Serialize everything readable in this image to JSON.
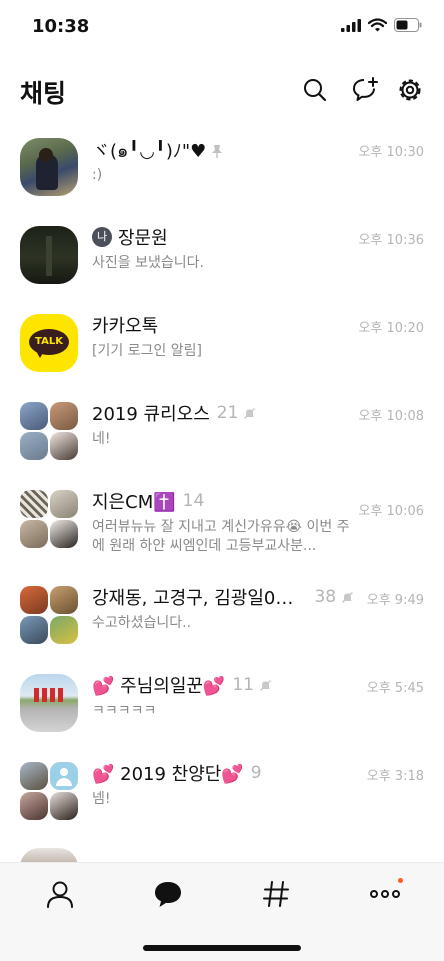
{
  "status_bar": {
    "time": "10:38"
  },
  "header": {
    "title": "채팅"
  },
  "chats": [
    {
      "name": "ヾ(๑╹◡╹)ﾉ\"♥",
      "message": ":)",
      "time": "오후 10:30",
      "pinned": true
    },
    {
      "name": "장문원",
      "message": "사진을 보냈습니다.",
      "time": "오후 10:36",
      "badge": "나"
    },
    {
      "name": "카카오톡",
      "message": "[기기 로그인 알림]",
      "time": "오후 10:20",
      "avatar_text": "TALK"
    },
    {
      "name": "2019 큐리오스",
      "count": "21",
      "message": "네!",
      "time": "오후 10:08",
      "muted": true
    },
    {
      "name": "지은CM✝️",
      "count": "14",
      "message": "여러뷰뉴뉴 잘 지내고 계신가유유😭 이번 주에 원래 하얀 씨엠인데 고등부교사분...",
      "time": "오후 10:06"
    },
    {
      "name": "강재동, 고경구, 김광일01...",
      "count": "38",
      "message": "수고하셨습니다..",
      "time": "오후 9:49",
      "muted": true
    },
    {
      "name": "💕 주님의일꾼💕",
      "count": "11",
      "message": "ㅋㅋㅋㅋㅋ",
      "time": "오후 5:45",
      "muted": true
    },
    {
      "name": "💕 2019 찬양단💕",
      "count": "9",
      "message": "넴!",
      "time": "오후 3:18"
    }
  ],
  "icons": {
    "search": "search-icon",
    "new_chat": "new-chat-icon",
    "settings": "gear-icon",
    "friends": "person-icon",
    "chats": "chat-bubble-icon",
    "open_chat": "hashtag-icon",
    "more": "more-icon"
  },
  "colors": {
    "kakao_yellow": "#FEE500",
    "notification_dot": "#FF5A1F"
  }
}
